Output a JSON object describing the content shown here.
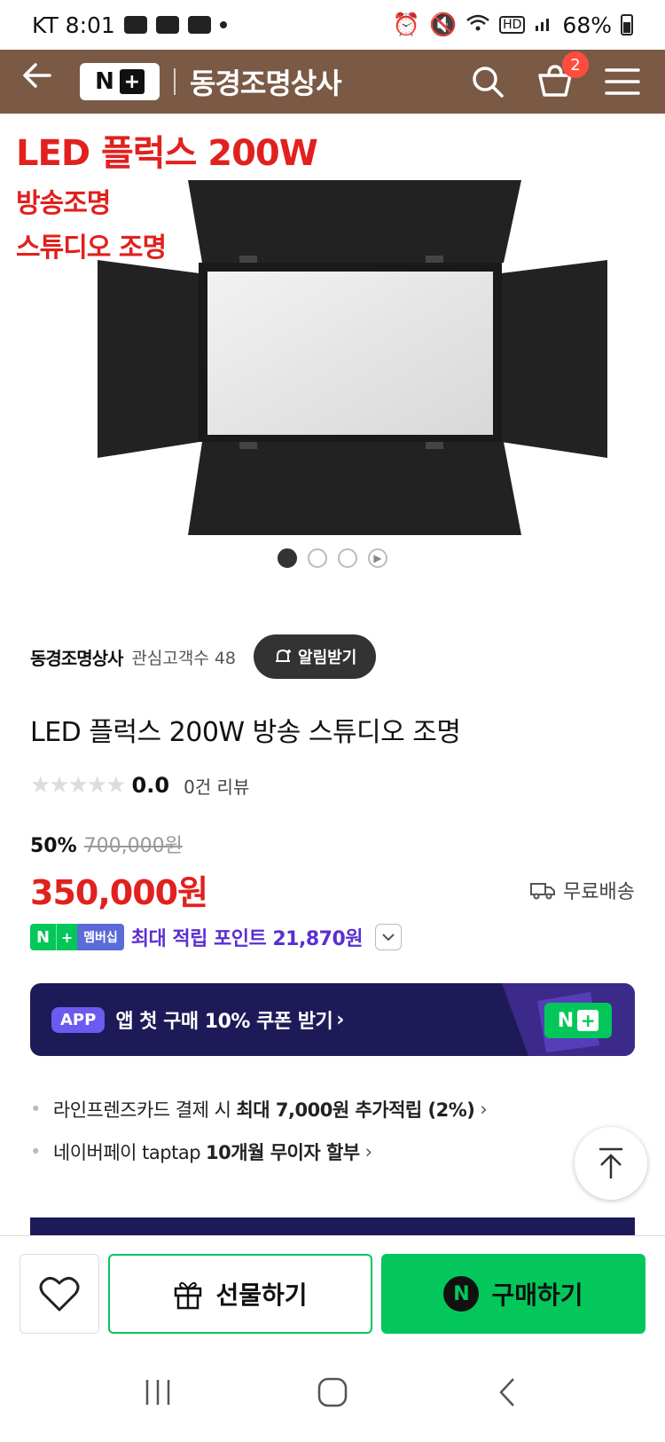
{
  "status_bar": {
    "carrier_time": "KT 8:01",
    "battery": "68%"
  },
  "header": {
    "logo_n": "N",
    "logo_plus": "+",
    "title": "동경조명상사",
    "cart_count": "2"
  },
  "hero": {
    "caption_line1": "LED 플럭스 200W",
    "caption_line2": "방송조명",
    "caption_line3": "스튜디오 조명",
    "slide_count": 3,
    "active_slide": 1
  },
  "seller": {
    "name": "동경조명상사",
    "followers": "관심고객수 48",
    "alert_button": "알림받기"
  },
  "product": {
    "title": "LED 플럭스 200W 방송 스튜디오 조명",
    "stars": "★★★★★",
    "rating": "0.0",
    "review_count": "0건 리뷰",
    "discount_rate": "50%",
    "original_price": "700,000원",
    "sale_price": "350,000원",
    "shipping": "무료배송"
  },
  "membership": {
    "badge_label": "멤버십",
    "points_text": "최대 적립 포인트 21,870원"
  },
  "app_banner": {
    "tag": "APP",
    "text": "앱 첫 구매 10% 쿠폰 받기",
    "arrow": "›"
  },
  "benefits": [
    {
      "plain": "라인프렌즈카드 결제 시",
      "bold": "최대 7,000원 추가적립 (2%)"
    },
    {
      "plain": "네이버페이 taptap",
      "bold": "10개월 무이자 할부"
    }
  ],
  "bottom_bar": {
    "gift_label": "선물하기",
    "buy_label": "구매하기",
    "buy_n": "N"
  },
  "colors": {
    "header_bg": "#7a5a45",
    "naver_green": "#03c75a",
    "price_red": "#e0211e",
    "points_purple": "#5b2fd0",
    "banner_navy": "#1d1a57"
  }
}
